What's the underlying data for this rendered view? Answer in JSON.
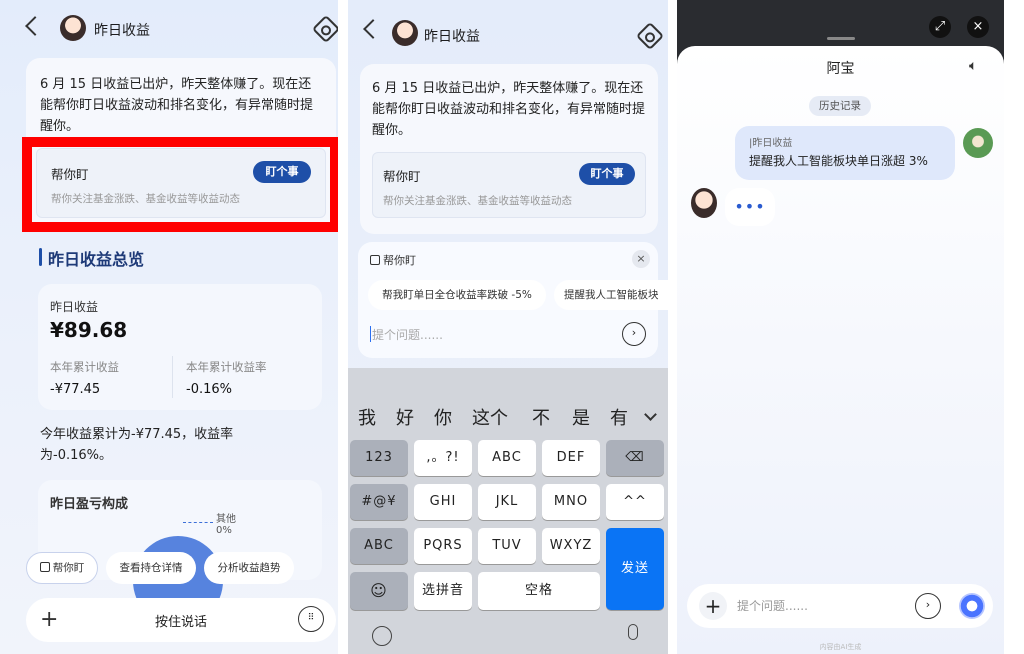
{
  "panel1": {
    "title": "昨日收益",
    "message": "6 月 15 日收益已出炉，昨天整体赚了。现在还能帮你盯日收益波动和排名变化，有异常随时提醒你。",
    "help_title": "帮你盯",
    "help_button": "盯个事",
    "help_sub": "帮你关注基金涨跌、基金收益等收益动态",
    "section_title": "昨日收益总览",
    "yesterday_label": "昨日收益",
    "yesterday_value": "¥89.68",
    "ytd_label": "本年累计收益",
    "ytd_value": "-¥77.45",
    "ytd_rate_label": "本年累计收益率",
    "ytd_rate_value": "-0.16%",
    "summary": "今年收益累计为-¥77.45，收益率为-0.16%。",
    "composition_title": "昨日盈亏构成",
    "other_label": "其他",
    "other_value": "0%",
    "chips": [
      "帮你盯",
      "查看持仓详情",
      "分析收益趋势"
    ],
    "talk_label": "按住说话"
  },
  "panel2": {
    "title": "昨日收益",
    "message": "6 月 15 日收益已出炉，昨天整体赚了。现在还能帮你盯日收益波动和排名变化，有异常随时提醒你。",
    "help_title": "帮你盯",
    "help_button": "盯个事",
    "help_sub": "帮你关注基金涨跌、基金收益等收益动态",
    "sheet_title": "帮你盯",
    "suggestions": [
      "帮我盯单日全仓收益率跌破 -5%",
      "提醒我人工智能板块"
    ],
    "input_placeholder": "提个问题......",
    "candidates": [
      "我",
      "好",
      "你",
      "这个",
      "不",
      "是",
      "有"
    ],
    "keys": {
      "row1": [
        "123",
        ",。?!",
        "ABC",
        "DEF"
      ],
      "row2": [
        "#@¥",
        "GHI",
        "JKL",
        "MNO",
        "^^"
      ],
      "row3": [
        "ABC",
        "PQRS",
        "TUV",
        "WXYZ"
      ],
      "pinyin": "选拼音",
      "space": "空格",
      "send": "发送"
    }
  },
  "panel3": {
    "title": "阿宝",
    "history_label": "历史记录",
    "user_tag": "|昨日收益",
    "user_message": "提醒我人工智能板块单日涨超 3%",
    "input_placeholder": "提个问题......",
    "footer_note": "内容由AI生成"
  }
}
